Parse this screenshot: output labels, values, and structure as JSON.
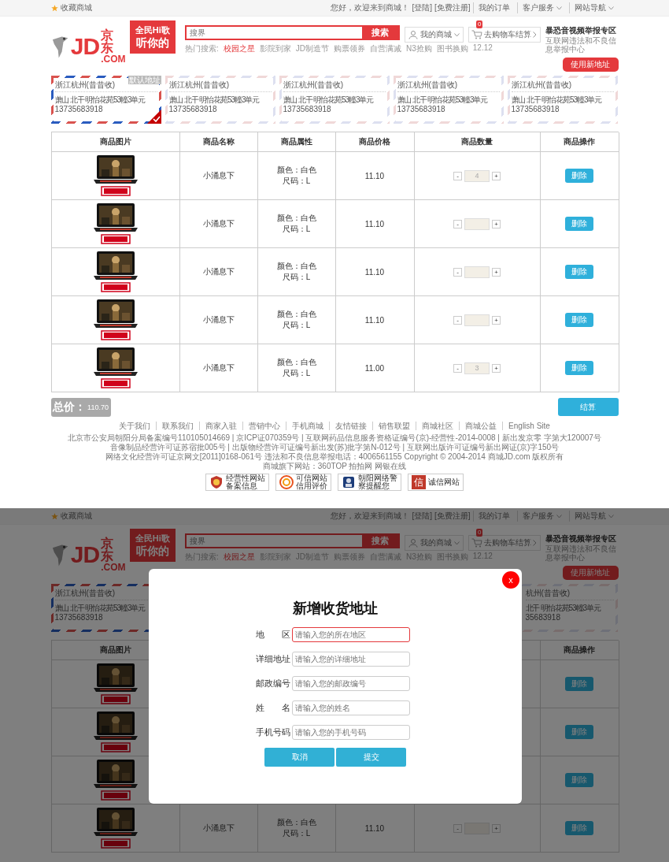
{
  "page": {
    "top_bar": {
      "favorite": "收藏商城",
      "greeting": "您好，欢迎来到商城！",
      "login": "[登陆]",
      "register": "[免费注册]",
      "links": [
        {
          "label": "我的订单",
          "dropdown": false
        },
        {
          "label": "客户服务",
          "dropdown": true
        },
        {
          "label": "网站导航",
          "dropdown": true
        }
      ]
    },
    "header": {
      "logo": {
        "latin": "JD",
        "chinese": "京东",
        "domain": ".COM"
      },
      "banner": [
        "全民Hi歌",
        "听你的"
      ],
      "search": {
        "placeholder": "搜界",
        "button": "搜索"
      },
      "hot_label": "热门搜索:",
      "hot_searches": [
        {
          "label": "校园之星",
          "highlighted": true
        },
        {
          "label": "影院到家",
          "highlighted": false
        },
        {
          "label": "JD制造节",
          "highlighted": false
        },
        {
          "label": "购票领券",
          "highlighted": false
        },
        {
          "label": "自营满减",
          "highlighted": false
        },
        {
          "label": "N3抢购",
          "highlighted": false
        },
        {
          "label": "图书换购",
          "highlighted": false
        },
        {
          "label": "12.12",
          "highlighted": false
        }
      ],
      "my_mall": "我的商城",
      "cart": {
        "label": "去购物车结算",
        "count": "0"
      },
      "report": {
        "title": "暴恐音视频举报专区",
        "subtitle": "互联网违法和不良信息举报中心"
      }
    },
    "new_address_button": "使用新地址",
    "addresses": [
      {
        "region": "浙江杭州(昔昔收)",
        "street": "萧山 北干 明怡花苑53幢3单元",
        "phone": "13735683918",
        "selected": true,
        "tag": "默认地址"
      },
      {
        "region": "浙江杭州(昔昔收)",
        "street": "萧山 北干 明怡花苑53幢3单元",
        "phone": "13735683918",
        "selected": false
      },
      {
        "region": "浙江杭州(昔昔收)",
        "street": "萧山 北干 明怡花苑53幢3单元",
        "phone": "13735683918",
        "selected": false
      },
      {
        "region": "浙江杭州(昔昔收)",
        "street": "萧山 北干 明怡花苑53幢3单元",
        "phone": "13735683918",
        "selected": false
      },
      {
        "region": "浙江杭州(昔昔收)",
        "street": "萧山 北干 明怡花苑53幢3单元",
        "phone": "13735683918",
        "selected": false
      }
    ],
    "table": {
      "columns": [
        "商品图片",
        "商品名称",
        "商品属性",
        "商品价格",
        "商品数量",
        "商品操作"
      ],
      "rows": [
        {
          "name": "小涌息下",
          "attributes": [
            "颜色：白色",
            "尺码：L"
          ],
          "price": "11.10",
          "stepper": {
            "minus": "-",
            "value": "4",
            "plus": "+"
          },
          "action": "删除"
        },
        {
          "name": "小涌息下",
          "attributes": [
            "颜色：白色",
            "尺码：L"
          ],
          "price": "11.10",
          "stepper": {
            "minus": "-",
            "plus": "+"
          },
          "action": "删除"
        },
        {
          "name": "小涌息下",
          "attributes": [
            "颜色：白色",
            "尺码：L"
          ],
          "price": "11.10",
          "stepper": {
            "minus": "-",
            "plus": "+"
          },
          "action": "删除"
        },
        {
          "name": "小涌息下",
          "attributes": [
            "颜色：白色",
            "尺码：L"
          ],
          "price": "11.10",
          "stepper": {
            "minus": "-",
            "plus": "+"
          },
          "action": "删除"
        },
        {
          "name": "小涌息下",
          "attributes": [
            "颜色：白色",
            "尺码：L"
          ],
          "price": "11.00",
          "stepper": {
            "minus": "-",
            "value": "3",
            "plus": "+"
          },
          "action": "删除"
        }
      ]
    },
    "summary": {
      "label": "总价：",
      "total": "110.70",
      "checkout": "结算"
    },
    "footer": {
      "links": [
        "关于我们",
        "联系我们",
        "商家入驻",
        "营销中心",
        "手机商城",
        "友情链接",
        "销售联盟",
        "商城社区",
        "商城公益",
        "English Site"
      ],
      "legal": [
        "北京市公安局朝阳分局备案编号110105014669 | 京ICP证070359号 | 互联网药品信息服务资格证编号(京)-经营性-2014-0008 | 新出发京零 字第大120007号",
        "音像制品经营许可证苏宿批005号 | 出版物经营许可证编号新出发(苏)批字第N-012号 | 互联网出版许可证编号新出网证(京)字150号",
        "网络文化经营许可证京网文[2011]0168-061号 违法和不良信息举报电话：4006561155 Copyright © 2004-2014 商城JD.com 版权所有",
        "商城旗下网站：360TOP 拍拍网 网银在线"
      ],
      "badges": [
        {
          "kind": "shield",
          "lines": [
            "经营性网站",
            "备案信息"
          ]
        },
        {
          "kind": "swirl",
          "lines": [
            "可信网站",
            "信用评价"
          ]
        },
        {
          "kind": "police",
          "lines": [
            "朝阳网络警",
            "察提醒您"
          ]
        },
        {
          "kind": "seal",
          "icon_text": "信",
          "lines": [
            "诚信网站"
          ]
        }
      ]
    }
  },
  "overlay_view": {
    "top_bar": {
      "favorite": "收藏商城",
      "greeting": "您好，欢迎来到商城！",
      "login": "[登陆]",
      "register": "[免费注册]",
      "links": [
        {
          "label": "我的订单",
          "dropdown": false
        },
        {
          "label": "客户服务",
          "dropdown": true
        },
        {
          "label": "网站导航",
          "dropdown": true
        }
      ]
    },
    "header": {
      "logo": {
        "latin": "JD",
        "chinese": "京东",
        "domain": ".COM"
      },
      "banner": [
        "全民Hi歌",
        "听你的"
      ],
      "search": {
        "placeholder": "搜界",
        "button": "搜索"
      },
      "hot_label": "热门搜索:",
      "hot_searches": [
        {
          "label": "校园之星",
          "highlighted": true
        },
        {
          "label": "影院到家",
          "highlighted": false
        },
        {
          "label": "JD制造节",
          "highlighted": false
        },
        {
          "label": "购票领券",
          "highlighted": false
        },
        {
          "label": "自营满减",
          "highlighted": false
        },
        {
          "label": "N3抢购",
          "highlighted": false
        },
        {
          "label": "图书换购",
          "highlighted": false
        },
        {
          "label": "12.12",
          "highlighted": false
        }
      ],
      "my_mall": "我的商城",
      "cart": {
        "label": "去购物车结算",
        "count": "0"
      },
      "report": {
        "title": "暴恐音视频举报专区",
        "subtitle": "互联网违法和不良信息举报中心"
      }
    },
    "new_address_button": "使用新地址",
    "addresses": {
      "left": {
        "region": "浙江杭州(昔昔收)",
        "street": "萧山 北干 明怡花苑53幢3单元",
        "phone": "13735683918",
        "selected": true
      },
      "right": {
        "region": "杭州(昔昔收)",
        "street": "北干 明怡花苑53幢3单元",
        "phone": "35683918",
        "selected": false
      }
    },
    "table": {
      "first_column": "商品图片",
      "last_column": "商品操作",
      "rows": [
        {
          "action": "删除"
        },
        {
          "action": "删除"
        },
        {
          "action": "删除"
        },
        {
          "name": "小涌息下",
          "attributes": [
            "颜色：白色",
            "尺码：L"
          ],
          "price": "11.10",
          "stepper": {
            "minus": "-",
            "plus": "+"
          },
          "action": "删除"
        }
      ]
    },
    "dialog": {
      "close": "x",
      "title": "新增收货地址",
      "fields": [
        {
          "label": "地 区",
          "placeholder": "请输入您的所在地区",
          "focused": true
        },
        {
          "label": "详细地址",
          "placeholder": "请输入您的详细地址",
          "focused": false
        },
        {
          "label": "邮政编号",
          "placeholder": "请输入您的邮政编号",
          "focused": false
        },
        {
          "label": "姓 名",
          "placeholder": "请输入您的姓名",
          "focused": false
        },
        {
          "label": "手机号码",
          "placeholder": "请输入您的手机号码",
          "focused": false
        }
      ],
      "buttons": [
        "取消",
        "提交"
      ]
    }
  }
}
